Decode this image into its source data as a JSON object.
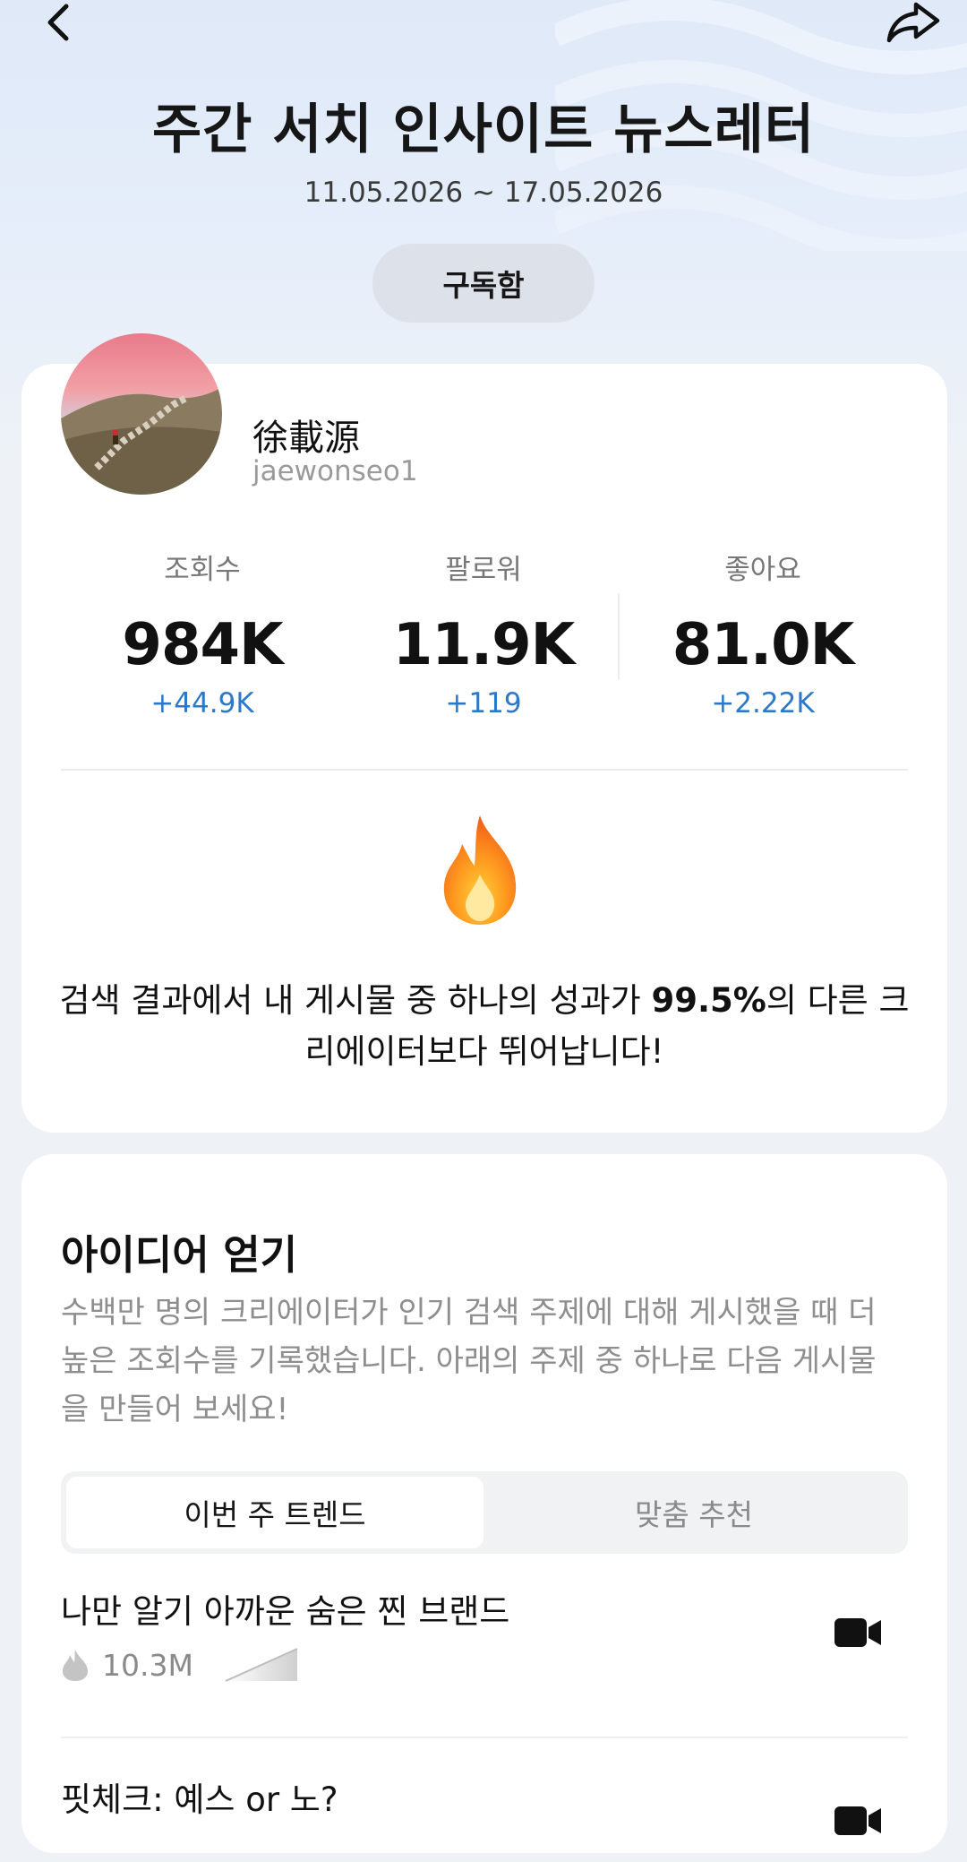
{
  "header": {
    "back_icon": "chevron-left-icon",
    "share_icon": "share-arrow-icon",
    "title": "주간 서치 인사이트 뉴스레터",
    "date_range": "11.05.2026 ~ 17.05.2026",
    "subscribe_label": "구독함"
  },
  "profile": {
    "display_name": "徐載源",
    "username": "jaewonseo1"
  },
  "stats": [
    {
      "label": "조회수",
      "value": "984K",
      "delta": "+44.9K"
    },
    {
      "label": "팔로워",
      "value": "11.9K",
      "delta": "+119"
    },
    {
      "label": "좋아요",
      "value": "81.0K",
      "delta": "+2.22K"
    }
  ],
  "performance": {
    "icon": "fire-icon",
    "text_before": "검색 결과에서 내 게시물 중 하나의 성과가 ",
    "highlight": "99.5%",
    "text_after": "의 다른 크리에이터보다 뛰어납니다!"
  },
  "ideas": {
    "title": "아이디어 얻기",
    "description": "수백만 명의 크리에이터가 인기 검색 주제에 대해 게시했을 때 더 높은 조회수를 기록했습니다. 아래의 주제 중 하나로 다음 게시물을 만들어 보세요!",
    "tabs": [
      {
        "label": "이번 주 트렌드",
        "active": true
      },
      {
        "label": "맞춤 추천",
        "active": false
      }
    ],
    "items": [
      {
        "title": "나만 알기 아까운 숨은 찐 브랜드",
        "count": "10.3M",
        "icon": "video-camera-icon"
      },
      {
        "title": "핏체크: 예스 or 노?",
        "count": "",
        "icon": "video-camera-icon"
      }
    ]
  },
  "colors": {
    "accent_blue": "#2c79c9",
    "fire_orange": "#f5821f"
  }
}
